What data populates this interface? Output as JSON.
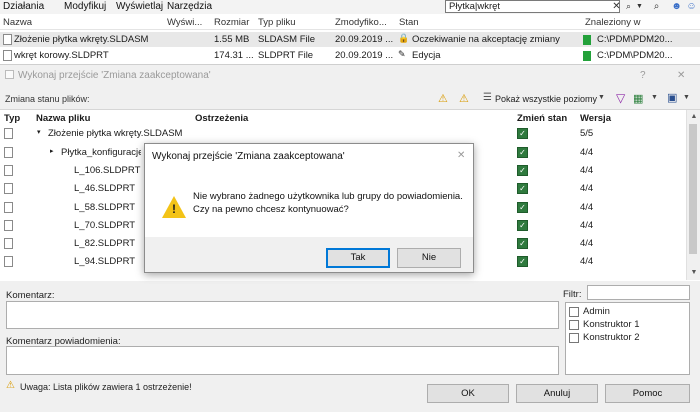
{
  "menubar": {
    "items": [
      "Działania",
      "Modyfikuj",
      "Wyświetlaj",
      "Narzędzia"
    ],
    "search_value": "Płytka|wkręt"
  },
  "columns": [
    "Nazwa",
    "Wyświ...",
    "Rozmiar",
    "Typ pliku",
    "Zmodyfiko...",
    "Stan",
    "Znaleziony w"
  ],
  "files": [
    {
      "name": "Złożenie płytka wkręty.SLDASM",
      "size": "1.55 MB",
      "type": "SLDASM File",
      "modified": "20.09.2019 ...",
      "state": "Oczekiwanie na akceptację zmiany",
      "found_in": "C:\\PDM\\PDM20..."
    },
    {
      "name": "wkręt korowy.SLDPRT",
      "size": "174.31 ...",
      "type": "SLDPRT File",
      "modified": "20.09.2019 ...",
      "state": "Edycja",
      "found_in": "C:\\PDM\\PDM20..."
    }
  ],
  "bg_dialog": {
    "title": "Wykonaj przejście 'Zmiana zaakceptowana'",
    "help_glyph": "?",
    "close_glyph": "✕",
    "toolbar_label": "Zmiana stanu plików:",
    "show_levels": "Pokaż wszystkie poziomy",
    "table_headers": {
      "type": "Typ",
      "name": "Nazwa pliku",
      "warnings": "Ostrzeżenia",
      "change_state": "Zmień stan",
      "version": "Wersja"
    },
    "rows": [
      {
        "name": "Złożenie płytka wkręty.SLDASM",
        "version": "5/5",
        "indent": 1,
        "tree": "▾"
      },
      {
        "name": "Płytka_konfiguracje",
        "version": "4/4",
        "indent": 2,
        "tree": "▸"
      },
      {
        "name": "L_106.SLDPRT",
        "version": "4/4",
        "indent": 3,
        "tree": ""
      },
      {
        "name": "L_46.SLDPRT",
        "version": "4/4",
        "indent": 3,
        "tree": ""
      },
      {
        "name": "L_58.SLDPRT",
        "version": "4/4",
        "indent": 3,
        "tree": ""
      },
      {
        "name": "L_70.SLDPRT",
        "version": "4/4",
        "indent": 3,
        "tree": ""
      },
      {
        "name": "L_82.SLDPRT",
        "version": "4/4",
        "indent": 3,
        "tree": ""
      },
      {
        "name": "L_94.SLDPRT",
        "version": "4/4",
        "indent": 3,
        "tree": ""
      }
    ],
    "comment_label": "Komentarz:",
    "notify_comment_label": "Komentarz powiadomienia:",
    "filter_label": "Filtr:",
    "filter_items": [
      "Admin",
      "Konstruktor 1",
      "Konstruktor 2"
    ],
    "warning_text": "Uwaga: Lista plików zawiera 1 ostrzeżenie!",
    "ok": "OK",
    "cancel": "Anuluj",
    "help": "Pomoc"
  },
  "modal": {
    "title": "Wykonaj przejście 'Zmiana zaakceptowana'",
    "close_glyph": "✕",
    "message_line1": "Nie wybrano żadnego użytkownika lub grupy do powiadomienia.",
    "message_line2": "Czy na pewno chcesz kontynuować?",
    "yes": "Tak",
    "no": "Nie"
  }
}
